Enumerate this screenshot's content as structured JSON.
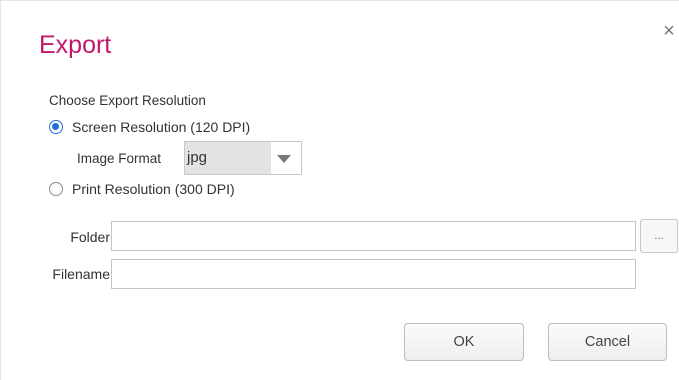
{
  "dialog": {
    "title": "Export",
    "close_glyph": "×",
    "close_icon": "close-icon"
  },
  "resolution": {
    "section_label": "Choose Export Resolution",
    "options": [
      {
        "label": "Screen Resolution (120 DPI)",
        "selected": true
      },
      {
        "label": "Print Resolution (300 DPI)",
        "selected": false
      }
    ]
  },
  "image_format": {
    "label": "Image Format",
    "value": "jpg",
    "icon": "dropdown-arrow-icon"
  },
  "folder": {
    "label": "Folder",
    "value": "",
    "browse_label": "..."
  },
  "filename": {
    "label": "Filename",
    "value": ""
  },
  "buttons": {
    "ok_label": "OK",
    "cancel_label": "Cancel"
  },
  "colors": {
    "title": "#c2186b",
    "radio_selected": "#1e6fd9"
  }
}
